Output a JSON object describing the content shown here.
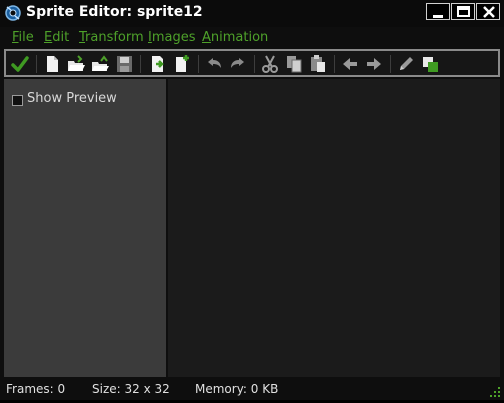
{
  "window": {
    "title": "Sprite Editor: sprite12",
    "app_icon": "sprite-editor-icon",
    "controls": [
      {
        "name": "minimize",
        "icon": "minimize-icon"
      },
      {
        "name": "maximize",
        "icon": "maximize-icon"
      },
      {
        "name": "close",
        "icon": "close-icon"
      }
    ]
  },
  "menu": {
    "file": {
      "accel": "F",
      "rest": "ile"
    },
    "edit": {
      "accel": "E",
      "rest": "dit"
    },
    "transform": {
      "accel": "T",
      "rest": "ransform"
    },
    "images": {
      "accel": "I",
      "rest": "mages"
    },
    "animation": {
      "accel": "A",
      "rest": "nimation"
    }
  },
  "toolbar": {
    "items": [
      "confirm-icon",
      "new-sprite-icon",
      "open-icon",
      "open-file-icon",
      "save-icon",
      "import-icon",
      "export-icon",
      "undo-icon",
      "redo-icon",
      "cut-icon",
      "copy-icon",
      "paste-icon",
      "previous-frame-icon",
      "next-frame-icon",
      "edit-image-icon",
      "layers-icon"
    ]
  },
  "left_panel": {
    "show_preview_label": "Show Preview",
    "show_preview_checked": false
  },
  "status": {
    "frames": "Frames: 0",
    "size": "Size: 32 x 32",
    "memory": "Memory: 0 KB"
  },
  "colors": {
    "accent_green": "#4ea12a",
    "toolbar_border": "#8a8a8a",
    "panel_bg": "#3b3b3b",
    "canvas_bg": "#1b1b1b"
  }
}
